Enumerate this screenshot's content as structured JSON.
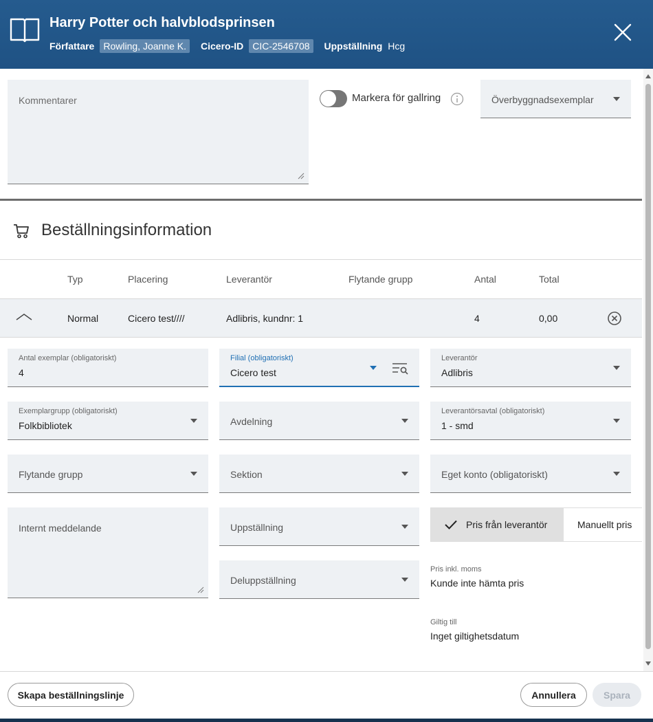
{
  "header": {
    "title": "Harry Potter och halvblodsprinsen",
    "author_label": "Författare",
    "author": "Rowling, Joanne K.",
    "cicero_label": "Cicero-ID",
    "cicero_id": "CIC-2546708",
    "shelving_label": "Uppställning",
    "shelving": "Hcg"
  },
  "top": {
    "comments_placeholder": "Kommentarer",
    "weed_toggle_label": "Markera för gallring",
    "weed_toggle_on": false,
    "superstructure_select": "Överbyggnadsexemplar"
  },
  "order_section": {
    "title": "Beställningsinformation",
    "columns": [
      "Typ",
      "Placering",
      "Leverantör",
      "Flytande grupp",
      "Antal",
      "Total"
    ],
    "row": {
      "type": "Normal",
      "placement": "Cicero test////",
      "supplier": "Adlibris, kundnr: 1",
      "floating_group": "",
      "count": "4",
      "total": "0,00"
    }
  },
  "form": {
    "copies": {
      "label": "Antal exemplar (obligatoriskt)",
      "value": "4"
    },
    "branch": {
      "label": "Filial (obligatoriskt)",
      "value": "Cicero test"
    },
    "supplier": {
      "label": "Leverantör",
      "value": "Adlibris"
    },
    "copy_group": {
      "label": "Exemplargrupp (obligatoriskt)",
      "value": "Folkbibliotek"
    },
    "department": {
      "placeholder": "Avdelning"
    },
    "supplier_agreement": {
      "label": "Leverantörsavtal (obligatoriskt)",
      "value": "1 - smd"
    },
    "floating_group": {
      "placeholder": "Flytande grupp"
    },
    "section": {
      "placeholder": "Sektion"
    },
    "own_account": {
      "placeholder": "Eget konto (obligatoriskt)"
    },
    "internal_message": {
      "placeholder": "Internt meddelande"
    },
    "shelving": {
      "placeholder": "Uppställning"
    },
    "sub_shelving": {
      "placeholder": "Deluppställning"
    },
    "price_source": {
      "options": [
        "Pris från leverantör",
        "Manuellt pris"
      ],
      "selected": "Pris från leverantör"
    },
    "price_incl_vat": {
      "label": "Pris inkl. moms",
      "value": "Kunde inte hämta pris"
    },
    "valid_until": {
      "label": "Giltig till",
      "value": "Inget giltighetsdatum"
    }
  },
  "footer": {
    "create_line": "Skapa beställningslinje",
    "cancel": "Annullera",
    "save": "Spara"
  },
  "colors": {
    "header_bg": "#1f5284",
    "field_bg": "#eef1f4",
    "accent": "#1f6fb3"
  }
}
